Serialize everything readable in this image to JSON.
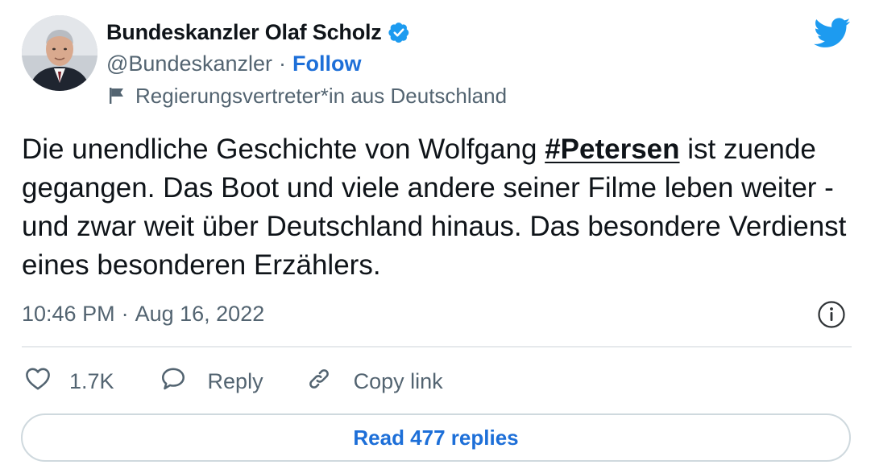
{
  "author": {
    "name": "Bundeskanzler Olaf Scholz",
    "handle": "@Bundeskanzler",
    "separator": "·",
    "follow_label": "Follow",
    "label": "Regierungsvertreter*in aus Deutschland"
  },
  "tweet": {
    "text_before": "Die unendliche Geschichte von Wolfgang ",
    "hashtag": "#Petersen",
    "text_after": " ist zuende gegangen. Das Boot und viele andere seiner Filme leben weiter - und zwar weit über Deutschland hinaus. Das besondere Verdienst eines besonderen Erzählers.",
    "time": "10:46 PM",
    "separator": "·",
    "date": "Aug 16, 2022"
  },
  "actions": {
    "like_count": "1.7K",
    "reply_label": "Reply",
    "copy_link_label": "Copy link"
  },
  "read_replies_label": "Read 477 replies",
  "icons": {
    "verified": "verified-badge-icon",
    "twitter": "twitter-bird-icon",
    "flag": "flag-icon",
    "info": "info-icon",
    "heart": "heart-icon",
    "reply": "speech-bubble-icon",
    "link": "link-icon"
  },
  "colors": {
    "accent": "#1d9bf0",
    "link": "#1d6fd8",
    "text": "#0f1419",
    "secondary": "#536471",
    "border": "#cfd9de"
  }
}
